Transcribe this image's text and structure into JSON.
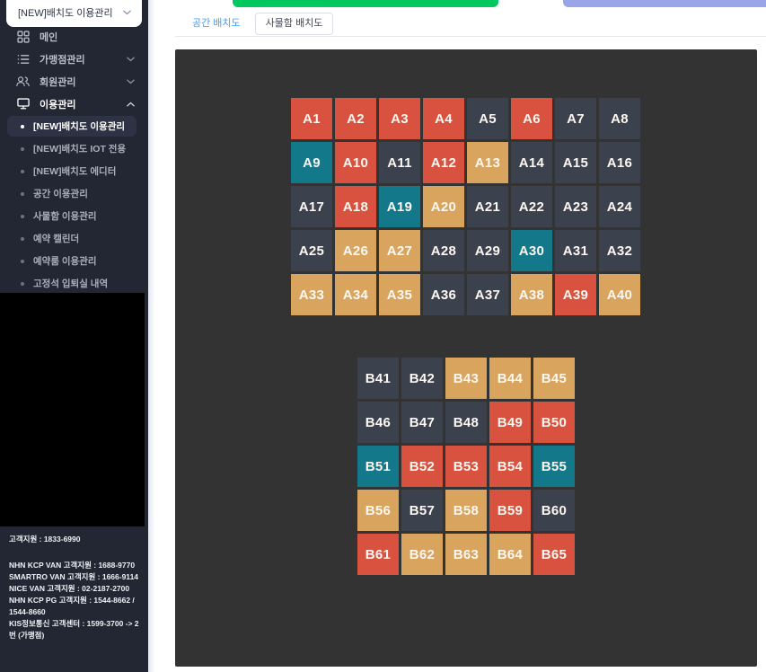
{
  "sidebar": {
    "dropdown_value": "[NEW]배치도 이용관리",
    "menu": [
      {
        "label": "메인",
        "icon": "dashboard-icon",
        "chevron": ""
      },
      {
        "label": "가맹점관리",
        "icon": "list-icon",
        "chevron": "down"
      },
      {
        "label": "회원관리",
        "icon": "members-icon",
        "chevron": "down"
      },
      {
        "label": "이용관리",
        "icon": "monitor-icon",
        "chevron": "up",
        "active": true
      }
    ],
    "submenu": [
      {
        "label": "[NEW]배치도 이용관리",
        "active": true
      },
      {
        "label": "[NEW]배치도 IOT 전용"
      },
      {
        "label": "[NEW]배치도 에디터"
      },
      {
        "label": "공간 이용관리"
      },
      {
        "label": "사물함 이용관리"
      },
      {
        "label": "예약 캘린더"
      },
      {
        "label": "예약룸 이용관리"
      },
      {
        "label": "고정석 입퇴실 내역"
      }
    ],
    "support_primary": "고객지원 : 1833-6990",
    "support_lines": [
      "NHN KCP VAN 고객지원 : 1688-9770",
      "SMARTRO VAN 고객지원 : 1666-9114",
      "NICE VAN 고객지원 : 02-2187-2700",
      "NHN KCP PG 고객지원 : 1544-8662 / 1544-8660",
      "KIS정보통신 고객센터 : 1599-3700 -> 2번 (가맹점)"
    ]
  },
  "main": {
    "tabs": [
      {
        "label": "공간 배치도",
        "selected": true
      },
      {
        "label": "사물함 배치도",
        "selected": false
      }
    ],
    "buttons": {
      "green_color": "#00c75e",
      "purple_color": "#9aa4e9"
    },
    "panel_background": "#333333",
    "seat_state_colors": {
      "gray": "#3c414e",
      "red": "#d9513f",
      "orange": "#d9a45e",
      "teal": "#13798a"
    },
    "seat_maps": [
      {
        "id": "zone-a",
        "columns": 8,
        "seats": [
          [
            "A1",
            "red"
          ],
          [
            "A2",
            "red"
          ],
          [
            "A3",
            "red"
          ],
          [
            "A4",
            "red"
          ],
          [
            "A5",
            "gray"
          ],
          [
            "A6",
            "red"
          ],
          [
            "A7",
            "gray"
          ],
          [
            "A8",
            "gray"
          ],
          [
            "A9",
            "teal"
          ],
          [
            "A10",
            "red"
          ],
          [
            "A11",
            "gray"
          ],
          [
            "A12",
            "red"
          ],
          [
            "A13",
            "orange"
          ],
          [
            "A14",
            "gray"
          ],
          [
            "A15",
            "gray"
          ],
          [
            "A16",
            "gray"
          ],
          [
            "A17",
            "gray"
          ],
          [
            "A18",
            "red"
          ],
          [
            "A19",
            "teal"
          ],
          [
            "A20",
            "orange"
          ],
          [
            "A21",
            "gray"
          ],
          [
            "A22",
            "gray"
          ],
          [
            "A23",
            "gray"
          ],
          [
            "A24",
            "gray"
          ],
          [
            "A25",
            "gray"
          ],
          [
            "A26",
            "orange"
          ],
          [
            "A27",
            "orange"
          ],
          [
            "A28",
            "gray"
          ],
          [
            "A29",
            "gray"
          ],
          [
            "A30",
            "teal"
          ],
          [
            "A31",
            "gray"
          ],
          [
            "A32",
            "gray"
          ],
          [
            "A33",
            "orange"
          ],
          [
            "A34",
            "orange"
          ],
          [
            "A35",
            "orange"
          ],
          [
            "A36",
            "gray"
          ],
          [
            "A37",
            "gray"
          ],
          [
            "A38",
            "orange"
          ],
          [
            "A39",
            "red"
          ],
          [
            "A40",
            "orange"
          ]
        ]
      },
      {
        "id": "zone-b",
        "columns": 5,
        "seats": [
          [
            "B41",
            "gray"
          ],
          [
            "B42",
            "gray"
          ],
          [
            "B43",
            "orange"
          ],
          [
            "B44",
            "orange"
          ],
          [
            "B45",
            "orange"
          ],
          [
            "B46",
            "gray"
          ],
          [
            "B47",
            "gray"
          ],
          [
            "B48",
            "gray"
          ],
          [
            "B49",
            "red"
          ],
          [
            "B50",
            "red"
          ],
          [
            "B51",
            "teal"
          ],
          [
            "B52",
            "red"
          ],
          [
            "B53",
            "red"
          ],
          [
            "B54",
            "red"
          ],
          [
            "B55",
            "teal"
          ],
          [
            "B56",
            "orange"
          ],
          [
            "B57",
            "gray"
          ],
          [
            "B58",
            "orange"
          ],
          [
            "B59",
            "red"
          ],
          [
            "B60",
            "gray"
          ],
          [
            "B61",
            "red"
          ],
          [
            "B62",
            "orange"
          ],
          [
            "B63",
            "orange"
          ],
          [
            "B64",
            "orange"
          ],
          [
            "B65",
            "red"
          ]
        ]
      }
    ]
  }
}
